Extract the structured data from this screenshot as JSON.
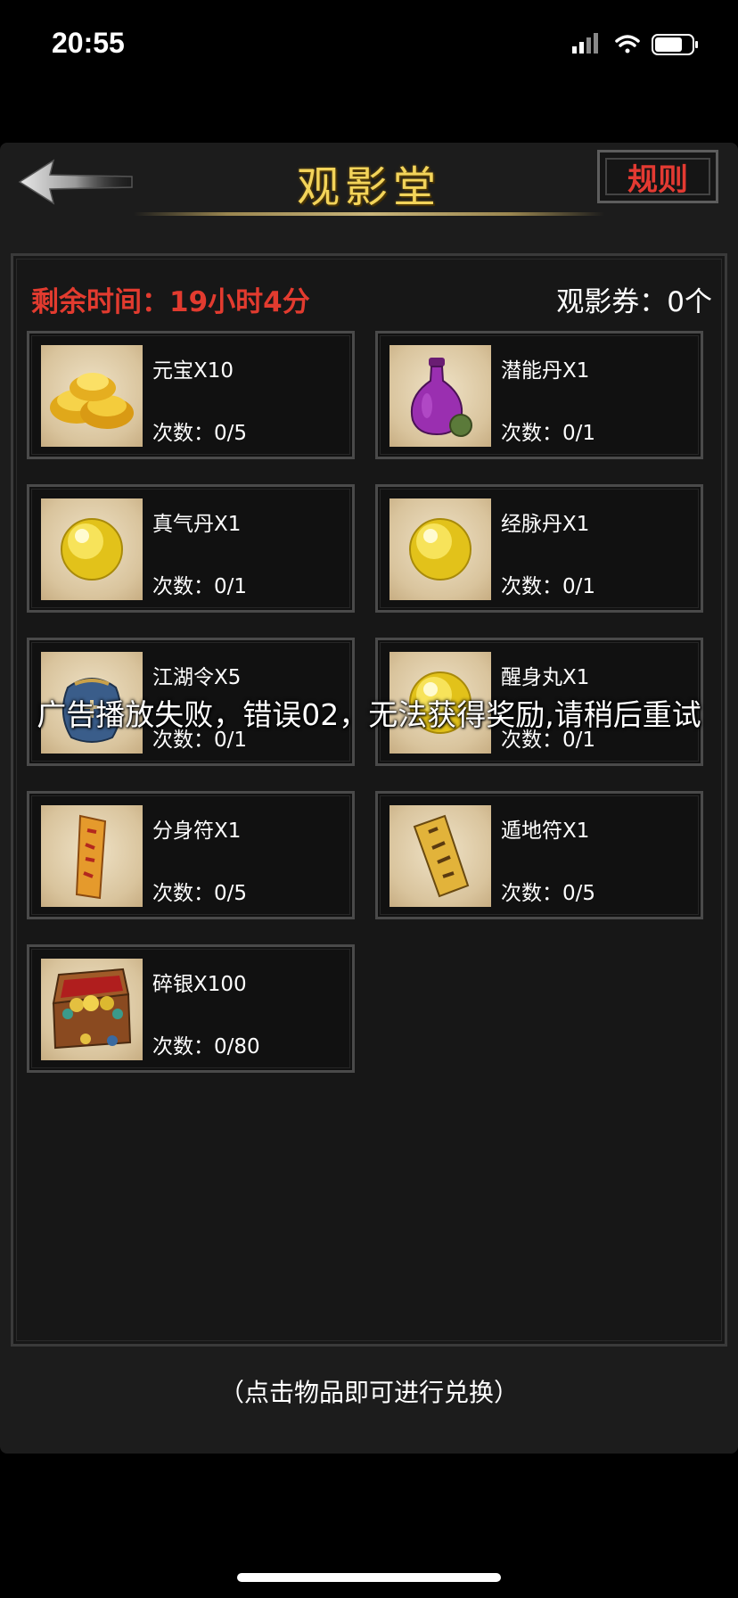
{
  "status_bar": {
    "time": "20:55",
    "icons": [
      "signal-icon",
      "wifi-icon",
      "battery-icon"
    ]
  },
  "header": {
    "title": "观影堂",
    "rules_label": "规则",
    "back_icon": "back-arrow-icon"
  },
  "info": {
    "remaining_time": "剩余时间：19小时4分",
    "tickets": "观影券：0个"
  },
  "items": [
    {
      "name": "元宝X10",
      "count": "次数：0/5",
      "icon": "gold-ingot-icon"
    },
    {
      "name": "潜能丹X1",
      "count": "次数：0/1",
      "icon": "potion-vase-icon"
    },
    {
      "name": "真气丹X1",
      "count": "次数：0/1",
      "icon": "yellow-pill-icon"
    },
    {
      "name": "经脉丹X1",
      "count": "次数：0/1",
      "icon": "yellow-pill-icon"
    },
    {
      "name": "江湖令X5",
      "count": "次数：0/1",
      "icon": "token-bag-icon"
    },
    {
      "name": "醒身丸X1",
      "count": "次数：0/1",
      "icon": "yellow-pill-icon"
    },
    {
      "name": "分身符X1",
      "count": "次数：0/5",
      "icon": "talisman-icon"
    },
    {
      "name": "遁地符X1",
      "count": "次数：0/5",
      "icon": "talisman-icon"
    },
    {
      "name": "碎银X100",
      "count": "次数：0/80",
      "icon": "treasure-chest-icon"
    }
  ],
  "toast": "广告播放失败，错误02，无法获得奖励,请稍后重试",
  "hint": "（点击物品即可进行兑换）",
  "colors": {
    "accent_title": "#f3d45a",
    "alert_red": "#e23b2f",
    "background": "#1c1c1c"
  }
}
